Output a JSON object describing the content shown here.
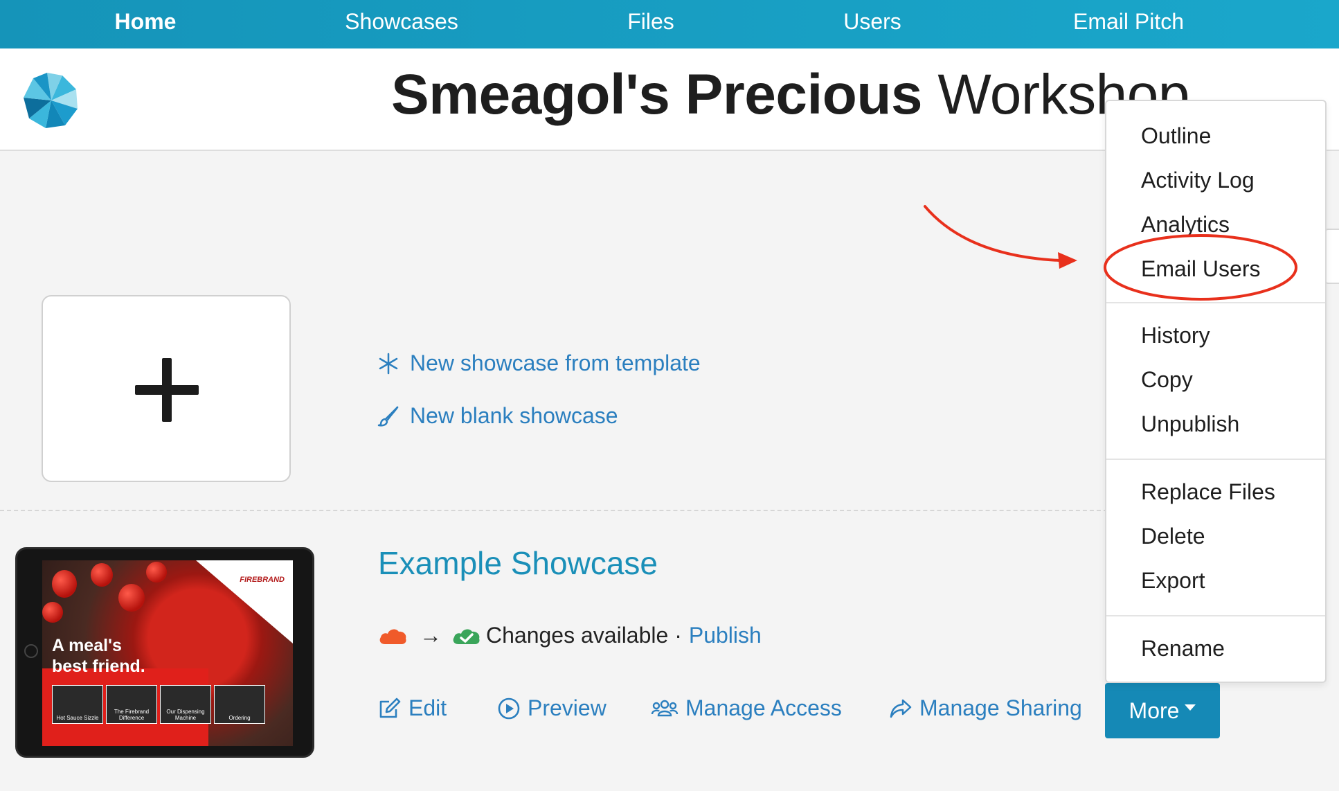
{
  "nav": {
    "items": [
      "Home",
      "Showcases",
      "Files",
      "Users",
      "Email Pitch"
    ],
    "active": "Home"
  },
  "header": {
    "title_bold": "Smeagol's Precious",
    "title_regular": "Workshop"
  },
  "create": {
    "template_link": "New showcase from template",
    "blank_link": "New blank showcase"
  },
  "showcase": {
    "title": "Example Showcase",
    "status_text": "Changes available ·",
    "arrow": "→",
    "publish_label": "Publish",
    "thumbnail": {
      "brand": "FIREBRAND",
      "tagline": "A meal's\nbest friend.",
      "tiles": [
        "Hot Sauce Sizzle",
        "The Firebrand Difference",
        "Our Dispensing Machine",
        "Ordering"
      ]
    },
    "actions": {
      "edit": "Edit",
      "preview": "Preview",
      "manage_access": "Manage Access",
      "manage_sharing": "Manage Sharing",
      "more": "More"
    }
  },
  "more_menu": {
    "groups": [
      [
        "Outline",
        "Activity Log",
        "Analytics",
        "Email Users"
      ],
      [
        "History",
        "Copy",
        "Unpublish"
      ],
      [
        "Replace Files",
        "Delete",
        "Export"
      ],
      [
        "Rename"
      ]
    ],
    "highlighted": "Email Users"
  },
  "colors": {
    "nav_bg": "#1aa7cb",
    "link": "#2b7fbf",
    "title_link": "#1a8fb8",
    "button": "#1589b6",
    "annotation": "#e8301c",
    "cloud_local": "#f05a2a",
    "cloud_synced": "#3aa55a"
  }
}
